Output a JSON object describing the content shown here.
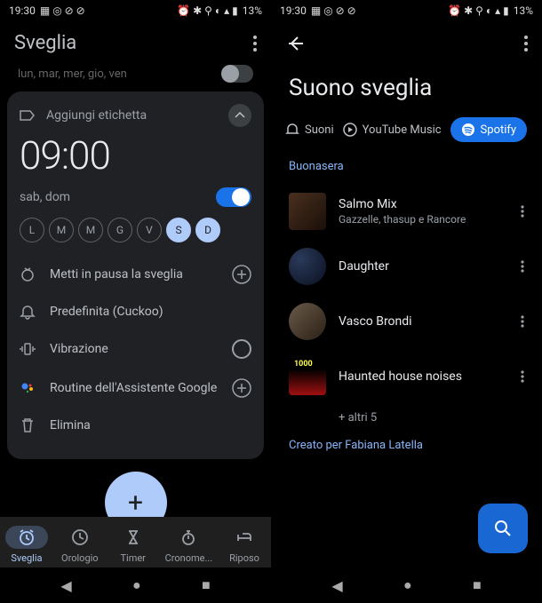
{
  "statusbar": {
    "time": "19:30",
    "battery": "13%"
  },
  "left": {
    "title": "Sveglia",
    "cutoff_days": "lun, mar, mer, gio, ven",
    "add_label": "Aggiungi etichetta",
    "time": "09:00",
    "days_label": "sab, dom",
    "chips": [
      "L",
      "M",
      "M",
      "G",
      "V",
      "S",
      "D"
    ],
    "pause": "Metti in pausa la sveglia",
    "sound": "Predefinita (Cuckoo)",
    "vibration": "Vibrazione",
    "assistant": "Routine dell'Assistente Google",
    "delete": "Elimina",
    "tabs": [
      "Sveglia",
      "Orologio",
      "Timer",
      "Cronome...",
      "Riposo"
    ]
  },
  "right": {
    "title": "Suono sveglia",
    "sources": {
      "sounds": "Suoni",
      "ytm": "YouTube Music",
      "spotify": "Spotify"
    },
    "section": "Buonasera",
    "songs": [
      {
        "title": "Salmo Mix",
        "sub": "Gazzelle, thasup e Rancore"
      },
      {
        "title": "Daughter",
        "sub": ""
      },
      {
        "title": "Vasco Brondi",
        "sub": ""
      },
      {
        "title": "Haunted house noises",
        "sub": ""
      }
    ],
    "more": "+ altri 5",
    "created": "Creato per Fabiana Latella"
  }
}
